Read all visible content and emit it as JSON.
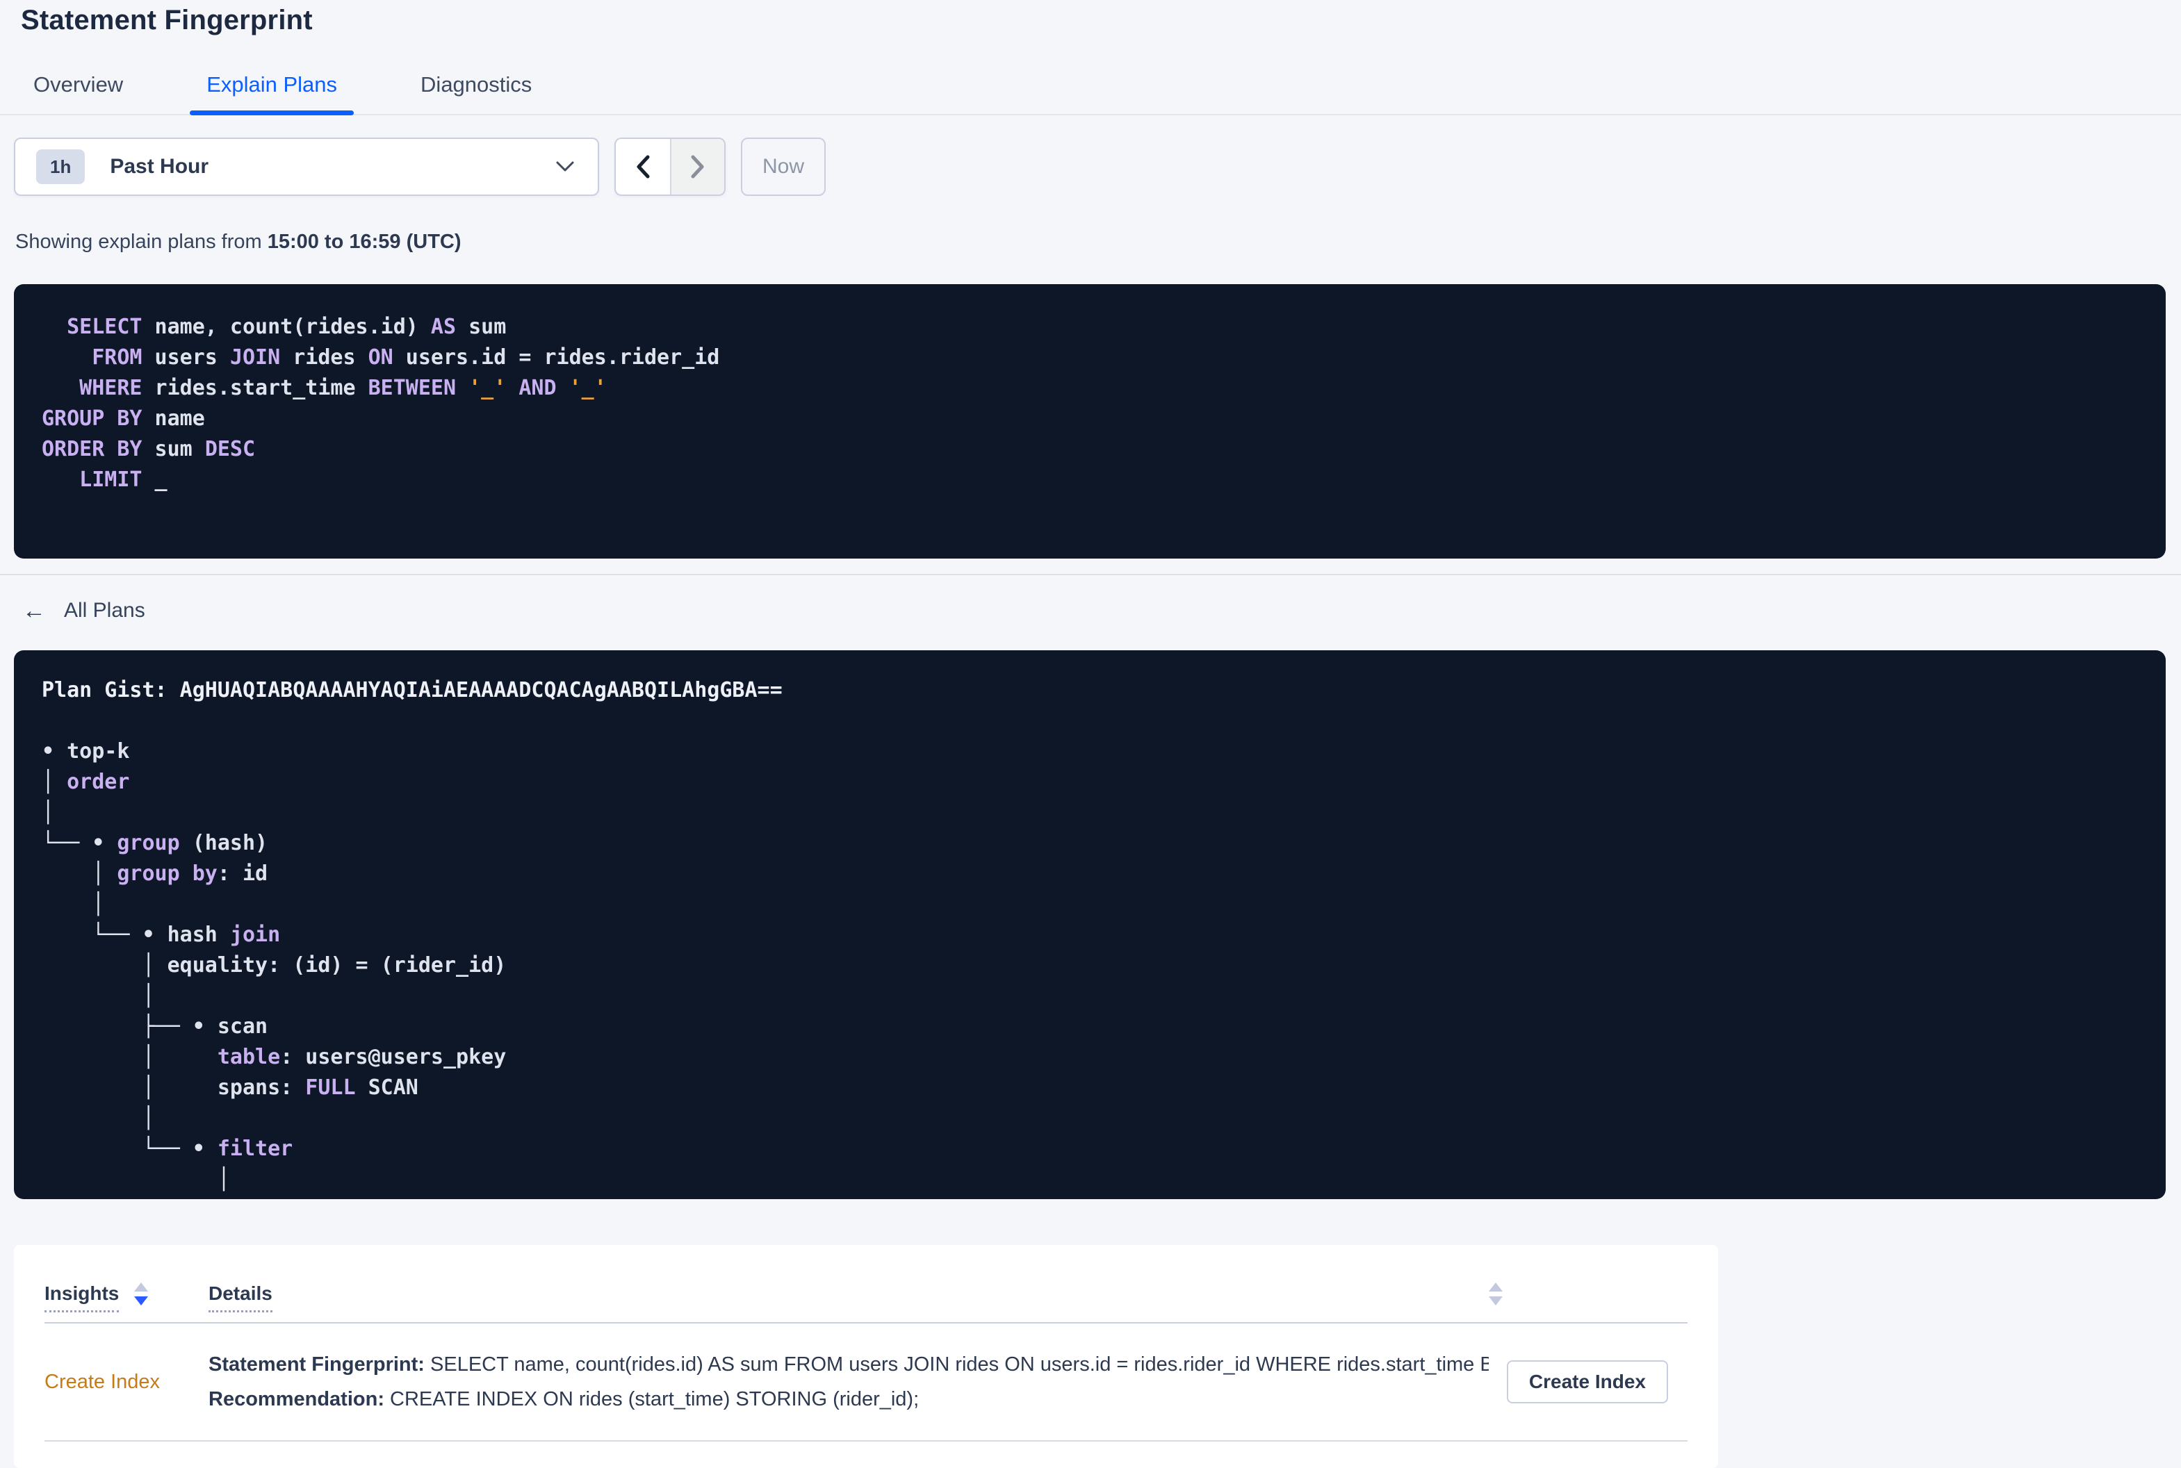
{
  "page": {
    "title": "Statement Fingerprint"
  },
  "tabs": [
    {
      "label": "Overview",
      "active": false
    },
    {
      "label": "Explain Plans",
      "active": true
    },
    {
      "label": "Diagnostics",
      "active": false
    }
  ],
  "time_picker": {
    "badge": "1h",
    "label": "Past Hour",
    "now_label": "Now"
  },
  "caption": {
    "prefix": "Showing explain plans from ",
    "bold": "15:00 to 16:59 (UTC)"
  },
  "sql": {
    "lines": [
      [
        {
          "t": "  SELECT",
          "c": "k"
        },
        {
          "t": " name, count(rides.id) ",
          "c": "p"
        },
        {
          "t": "AS",
          "c": "k"
        },
        {
          "t": " sum",
          "c": "p"
        }
      ],
      [
        {
          "t": "    FROM",
          "c": "k"
        },
        {
          "t": " users ",
          "c": "p"
        },
        {
          "t": "JOIN",
          "c": "k"
        },
        {
          "t": " rides ",
          "c": "p"
        },
        {
          "t": "ON",
          "c": "k"
        },
        {
          "t": " users.id = rides.rider_id",
          "c": "p"
        }
      ],
      [
        {
          "t": "   WHERE",
          "c": "k"
        },
        {
          "t": " rides.start_time ",
          "c": "p"
        },
        {
          "t": "BETWEEN",
          "c": "k"
        },
        {
          "t": " ",
          "c": "p"
        },
        {
          "t": "'_'",
          "c": "s"
        },
        {
          "t": " ",
          "c": "p"
        },
        {
          "t": "AND",
          "c": "k"
        },
        {
          "t": " ",
          "c": "p"
        },
        {
          "t": "'_'",
          "c": "s"
        }
      ],
      [
        {
          "t": "GROUP BY",
          "c": "k"
        },
        {
          "t": " name",
          "c": "p"
        }
      ],
      [
        {
          "t": "ORDER BY",
          "c": "k"
        },
        {
          "t": " sum ",
          "c": "p"
        },
        {
          "t": "DESC",
          "c": "k"
        }
      ],
      [
        {
          "t": "   LIMIT",
          "c": "k"
        },
        {
          "t": " _",
          "c": "p"
        }
      ]
    ]
  },
  "all_plans": {
    "arrow": "←",
    "label": "All Plans"
  },
  "gist": {
    "lines": [
      [
        {
          "t": "Plan Gist: AgHUAQIABQAAAAHYAQIAiAEAAAADCQACAgAABQILAhgGBA==",
          "c": "b"
        }
      ],
      [],
      [
        {
          "t": "• top-k",
          "c": "p"
        }
      ],
      [
        {
          "t": "│ ",
          "c": "p"
        },
        {
          "t": "order",
          "c": "k"
        }
      ],
      [
        {
          "t": "│",
          "c": "p"
        }
      ],
      [
        {
          "t": "└── • ",
          "c": "p"
        },
        {
          "t": "group",
          "c": "k"
        },
        {
          "t": " (hash)",
          "c": "p"
        }
      ],
      [
        {
          "t": "    │ ",
          "c": "p"
        },
        {
          "t": "group by",
          "c": "k"
        },
        {
          "t": ": id",
          "c": "p"
        }
      ],
      [
        {
          "t": "    │",
          "c": "p"
        }
      ],
      [
        {
          "t": "    └── • hash ",
          "c": "p"
        },
        {
          "t": "join",
          "c": "k"
        }
      ],
      [
        {
          "t": "        │ equality: (id) = (rider_id)",
          "c": "p"
        }
      ],
      [
        {
          "t": "        │",
          "c": "p"
        }
      ],
      [
        {
          "t": "        ├── • scan",
          "c": "p"
        }
      ],
      [
        {
          "t": "        │     ",
          "c": "p"
        },
        {
          "t": "table",
          "c": "k"
        },
        {
          "t": ": users@users_pkey",
          "c": "p"
        }
      ],
      [
        {
          "t": "        │     spans: ",
          "c": "p"
        },
        {
          "t": "FULL",
          "c": "k"
        },
        {
          "t": " SCAN",
          "c": "p"
        }
      ],
      [
        {
          "t": "        │",
          "c": "p"
        }
      ],
      [
        {
          "t": "        └── • ",
          "c": "p"
        },
        {
          "t": "filter",
          "c": "k"
        }
      ],
      [
        {
          "t": "              │",
          "c": "p"
        }
      ]
    ]
  },
  "insights_table": {
    "columns": [
      "Insights",
      "Details"
    ],
    "row": {
      "insight": "Create Index",
      "fingerprint_label": "Statement Fingerprint:",
      "fingerprint_text": " SELECT name, count(rides.id) AS sum FROM users JOIN rides ON users.id = rides.rider_id WHERE rides.start_time BETWEEN '_…",
      "recommendation_label": "Recommendation:",
      "recommendation_text": " CREATE INDEX ON rides (start_time) STORING (rider_id);",
      "action_label": "Create Index"
    }
  },
  "icons": {
    "dropdown_caret": "chevron-down",
    "prev": "chevron-left",
    "next": "chevron-right",
    "back": "arrow-left",
    "sort": "triangles-up-down"
  },
  "colors": {
    "accent_blue": "#0b5fff",
    "sort_active_blue": "#2b5bff",
    "insight_orange": "#c77b17",
    "code_background": "#0e1728",
    "code_keyword": "#c9b1f1",
    "code_plain": "#dee3ee",
    "code_string": "#e7a03c",
    "page_background": "#f5f6fa"
  }
}
